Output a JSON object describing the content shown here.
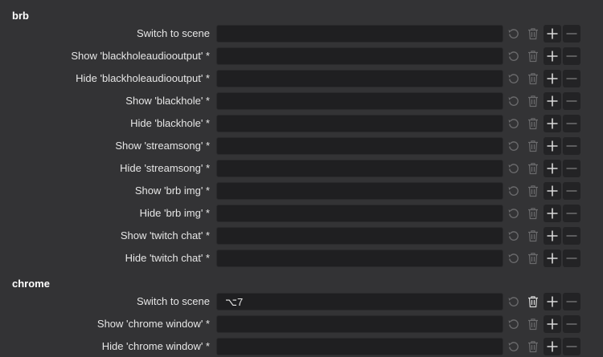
{
  "sections": [
    {
      "title": "brb",
      "rows": [
        {
          "label": "Switch to scene",
          "value": ""
        },
        {
          "label": "Show 'blackholeaudiooutput' *",
          "value": ""
        },
        {
          "label": "Hide 'blackholeaudiooutput' *",
          "value": ""
        },
        {
          "label": "Show 'blackhole' *",
          "value": ""
        },
        {
          "label": "Hide 'blackhole' *",
          "value": ""
        },
        {
          "label": "Show 'streamsong' *",
          "value": ""
        },
        {
          "label": "Hide 'streamsong' *",
          "value": ""
        },
        {
          "label": "Show 'brb img' *",
          "value": ""
        },
        {
          "label": "Hide 'brb img' *",
          "value": ""
        },
        {
          "label": "Show 'twitch chat' *",
          "value": ""
        },
        {
          "label": "Hide 'twitch chat' *",
          "value": ""
        }
      ]
    },
    {
      "title": "chrome",
      "rows": [
        {
          "label": "Switch to scene",
          "value": "⌥7"
        },
        {
          "label": "Show 'chrome window' *",
          "value": ""
        },
        {
          "label": "Hide 'chrome window' *",
          "value": ""
        }
      ]
    }
  ],
  "icons": {
    "reset": "reset-icon",
    "delete": "trash-icon",
    "add": "plus-icon",
    "remove": "minus-icon"
  },
  "colors": {
    "background": "#333335",
    "field": "#1f1f21",
    "icon_dim": "#6a6a6c",
    "icon_active": "#d8d8d8"
  }
}
